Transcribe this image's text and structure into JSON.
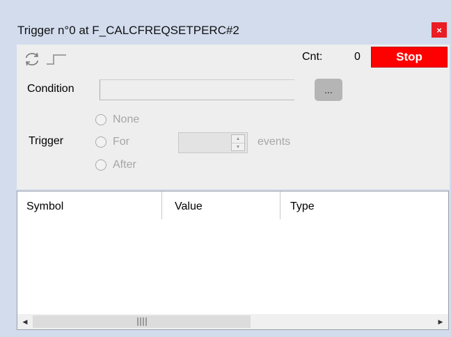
{
  "window": {
    "title": "Trigger n°0 at F_CALCFREQSETPERC#2",
    "close_label": "×"
  },
  "toolbar": {
    "refresh_icon": "refresh-icon",
    "edge_icon": "step-edge-icon",
    "count_label": "Cnt:",
    "count_value": "0",
    "stop_label": "Stop"
  },
  "condition": {
    "label": "Condition",
    "value": "",
    "browse_label": "..."
  },
  "trigger": {
    "label": "Trigger",
    "options": [
      "None",
      "For",
      "After"
    ],
    "count_value": "",
    "unit_label": "events"
  },
  "table": {
    "columns": [
      "Symbol",
      "Value",
      "Type"
    ],
    "rows": []
  },
  "colors": {
    "stop": "#ff0000",
    "close": "#ea1c24",
    "frame": "#d2dced"
  }
}
